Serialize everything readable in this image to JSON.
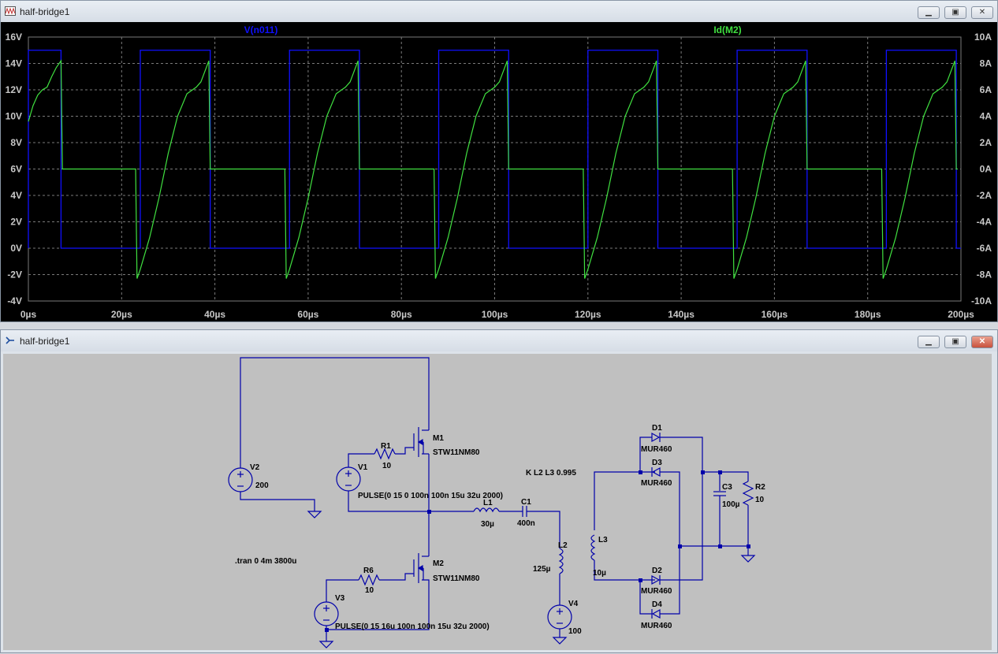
{
  "waveform_window": {
    "title": "half-bridge1",
    "trace1_label": "V(n011)",
    "trace2_label": "Id(M2)",
    "colors": {
      "trace1": "#1010ff",
      "trace2": "#40e040",
      "background": "#000000",
      "axis_text": "#c8c8c8",
      "grid": "#7a7a7a"
    }
  },
  "schematic_window": {
    "title": "half-bridge1",
    "wire_color": "#0000aa",
    "labels": {
      "M1": "M1",
      "M1_model": "STW11NM80",
      "M2": "M2",
      "M2_model": "STW11NM80",
      "R1": "R1",
      "R1_val": "10",
      "R6": "R6",
      "R6_val": "10",
      "V1": "V1",
      "V1_pulse": "PULSE(0 15 0 100n 100n 15u 32u 2000)",
      "V2": "V2",
      "V2_val": "200",
      "V3": "V3",
      "V3_pulse": "PULSE(0 15 16u 100n 100n 15u 32u 2000)",
      "V4": "V4",
      "V4_val": "100",
      "L1": "L1",
      "L1_val": "30µ",
      "C1": "C1",
      "C1_val": "400n",
      "L2": "L2",
      "L2_val": "125µ",
      "L3": "L3",
      "L3_val": "10µ",
      "coupling": "K L2 L3 0.995",
      "tran": ".tran 0 4m 3800u",
      "D1": "D1",
      "D1_model": "MUR460",
      "D2": "D2",
      "D2_model": "MUR460",
      "D3": "D3",
      "D3_model": "MUR460",
      "D4": "D4",
      "D4_model": "MUR460",
      "C3": "C3",
      "C3_val": "100µ",
      "R2": "R2",
      "R2_val": "10"
    }
  },
  "chart_data": {
    "type": "line",
    "title": "",
    "x_unit": "µs",
    "xlim": [
      0,
      200
    ],
    "x_ticks": [
      "0µs",
      "20µs",
      "40µs",
      "60µs",
      "80µs",
      "100µs",
      "120µs",
      "140µs",
      "160µs",
      "180µs",
      "200µs"
    ],
    "y_left": {
      "label": "",
      "unit": "V",
      "lim": [
        -4,
        16
      ],
      "ticks": [
        "-4V",
        "-2V",
        "0V",
        "2V",
        "4V",
        "6V",
        "8V",
        "10V",
        "12V",
        "14V",
        "16V"
      ]
    },
    "y_right": {
      "label": "",
      "unit": "A",
      "lim": [
        -10,
        10
      ],
      "ticks": [
        "-10A",
        "-8A",
        "-6A",
        "-4A",
        "-2A",
        "0A",
        "2A",
        "4A",
        "6A",
        "8A",
        "10A"
      ]
    },
    "grid": true,
    "series": [
      {
        "name": "V(n011)",
        "axis": "left",
        "period_us": 32,
        "high_v": 15,
        "low_v": 0,
        "high_intervals_us": [
          [
            0,
            7
          ],
          [
            24,
            39
          ],
          [
            56,
            71
          ],
          [
            88,
            103
          ],
          [
            120,
            135
          ],
          [
            152,
            167
          ],
          [
            184,
            199
          ]
        ]
      },
      {
        "name": "Id(M2)",
        "axis": "right",
        "period_us": 32,
        "points": [
          [
            0,
            3.6
          ],
          [
            1,
            4.8
          ],
          [
            2,
            5.6
          ],
          [
            3,
            6.0
          ],
          [
            4,
            6.2
          ],
          [
            5,
            7.0
          ],
          [
            6,
            7.7
          ],
          [
            7,
            8.2
          ],
          [
            7.3,
            0.0
          ],
          [
            23,
            0.0
          ],
          [
            23.3,
            -8.3
          ],
          [
            24,
            -7.6
          ],
          [
            26,
            -5.2
          ],
          [
            28,
            -2.2
          ],
          [
            30,
            1.2
          ],
          [
            32,
            4.0
          ],
          [
            34,
            5.7
          ],
          [
            36,
            6.2
          ],
          [
            37,
            6.6
          ],
          [
            38.7,
            8.2
          ],
          [
            39,
            0.0
          ]
        ]
      }
    ]
  }
}
